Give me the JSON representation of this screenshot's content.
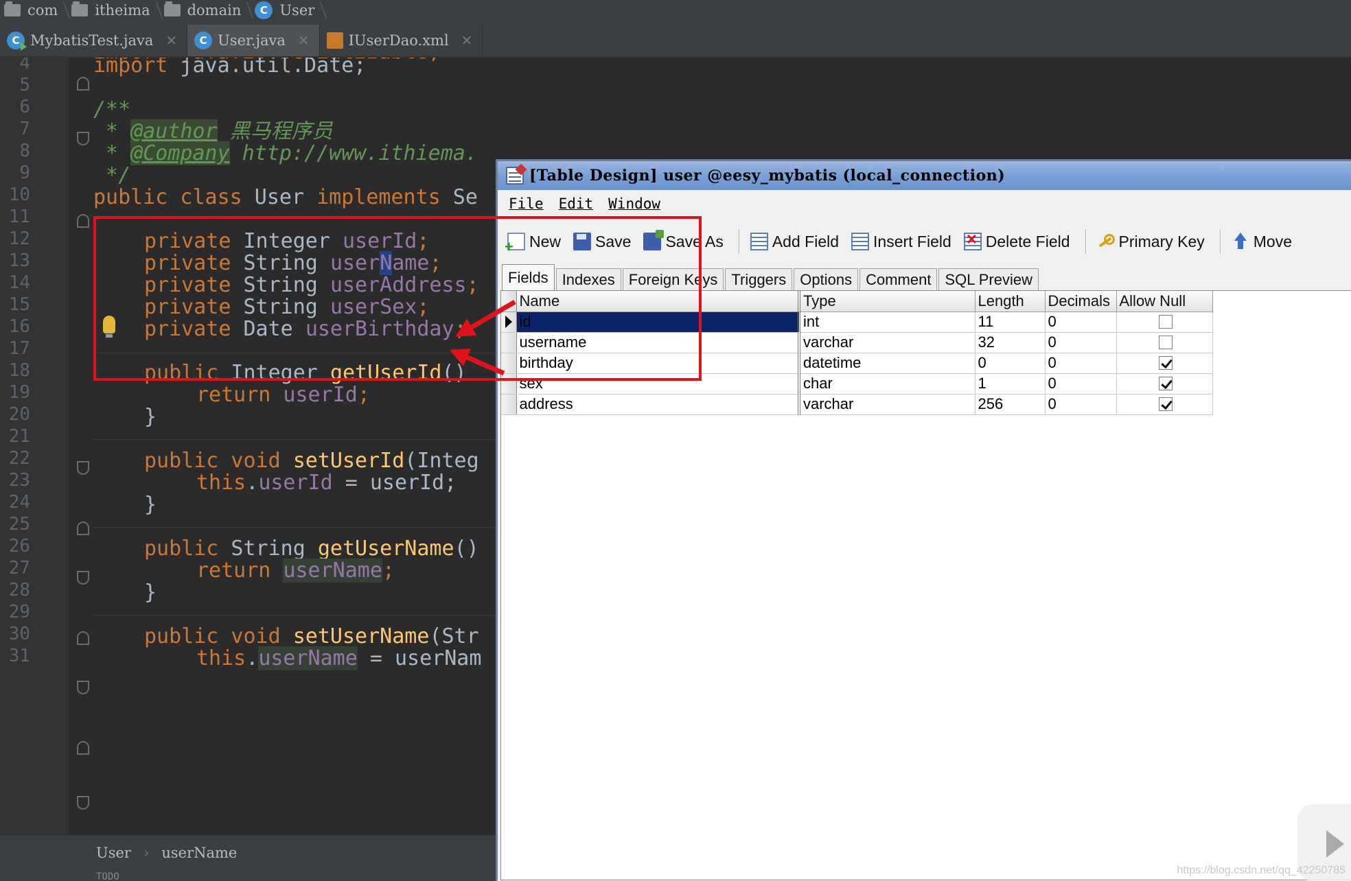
{
  "breadcrumb": [
    "com",
    "itheima",
    "domain",
    "User"
  ],
  "editor_tabs": [
    {
      "label": "MybatisTest.java",
      "icon": "java-run-icon"
    },
    {
      "label": "User.java",
      "icon": "java-class-icon"
    },
    {
      "label": "IUserDao.xml",
      "icon": "xml-file-icon"
    }
  ],
  "line_numbers": [
    "4",
    "5",
    "6",
    "7",
    "8",
    "9",
    "10",
    "11",
    "12",
    "13",
    "14",
    "15",
    "16",
    "17",
    "18",
    "19",
    "20",
    "21",
    "22",
    "23",
    "24",
    "25",
    "26",
    "27",
    "28",
    "29",
    "30",
    "31"
  ],
  "code": {
    "partial_top": "import java.io.Serializable;",
    "l4_kw": "import",
    "l4_rest": " java.util.Date;",
    "l6": "/**",
    "l7_star": " * ",
    "l7_tag": "@author",
    "l7_text": " 黑马程序员",
    "l8_star": " * ",
    "l8_tag": "@Company",
    "l8_text": " http://www.ithiema.",
    "l9": " */",
    "l10_kw1": "public class",
    "l10_name": " User ",
    "l10_kw2": "implements",
    "l10_rest": " Se",
    "l12_kw": "private",
    "l12_type": " Integer ",
    "l12_fld": "userId",
    "l12_end": ";",
    "l13_kw": "private",
    "l13_type": " String ",
    "l13_fld_a": "user",
    "l13_fld_b": "N",
    "l13_fld_c": "ame",
    "l13_end": ";",
    "l14_kw": "private",
    "l14_type": " String ",
    "l14_fld": "userAddress",
    "l14_end": ";",
    "l15_kw": "private",
    "l15_type": " String ",
    "l15_fld": "userSex",
    "l15_end": ";",
    "l16_kw": "private",
    "l16_type": " Date ",
    "l16_fld": "userBirthday",
    "l16_end": ";",
    "l18_kw": "public",
    "l18_type": " Integer ",
    "l18_fn": "getUserId",
    "l18_end": "()",
    "l19_kw": "return",
    "l19_fld": " userId",
    "l19_end": ";",
    "brace": "}",
    "l22_kw": "public void",
    "l22_fn": " setUserId",
    "l22_end": "(Integ",
    "l23_kw": "this",
    "l23_dot": ".",
    "l23_fld": "userId",
    "l23_end": " = userId;",
    "l26_kw": "public",
    "l26_type": " String ",
    "l26_fn": "getUserName",
    "l26_end": "()",
    "l27_kw": "return",
    "l27_sp": " ",
    "l27_fld": "userName",
    "l27_end": ";",
    "l30_kw": "public void",
    "l30_fn": " setUserName",
    "l30_end": "(Str",
    "l31_kw": "this",
    "l31_dot": ".",
    "l31_fld": "userName",
    "l31_end": " = userNam"
  },
  "status_path": [
    "User",
    "userName"
  ],
  "bottom_hint": "TODO",
  "navicat": {
    "title": "[Table Design] user @eesy_mybatis (local_connection)",
    "menu": [
      "File",
      "Edit",
      "Window"
    ],
    "toolbar": [
      {
        "label": "New",
        "icon": "new-table-icon"
      },
      {
        "label": "Save",
        "icon": "save-icon"
      },
      {
        "label": "Save As",
        "icon": "save-as-icon"
      },
      {
        "label": "Add Field",
        "icon": "add-field-icon"
      },
      {
        "label": "Insert Field",
        "icon": "insert-field-icon"
      },
      {
        "label": "Delete Field",
        "icon": "delete-field-icon"
      },
      {
        "label": "Primary Key",
        "icon": "key-icon"
      },
      {
        "label": "Move",
        "icon": "move-up-icon"
      }
    ],
    "tabs": [
      "Fields",
      "Indexes",
      "Foreign Keys",
      "Triggers",
      "Options",
      "Comment",
      "SQL Preview"
    ],
    "active_tab": "Fields",
    "columns": [
      "Name",
      "Type",
      "Length",
      "Decimals",
      "Allow Null"
    ],
    "rows": [
      {
        "name": "id",
        "type": "int",
        "length": "11",
        "decimals": "0",
        "allow_null": false,
        "selected": true
      },
      {
        "name": "username",
        "type": "varchar",
        "length": "32",
        "decimals": "0",
        "allow_null": false,
        "selected": false
      },
      {
        "name": "birthday",
        "type": "datetime",
        "length": "0",
        "decimals": "0",
        "allow_null": true,
        "selected": false
      },
      {
        "name": "sex",
        "type": "char",
        "length": "1",
        "decimals": "0",
        "allow_null": true,
        "selected": false
      },
      {
        "name": "address",
        "type": "varchar",
        "length": "256",
        "decimals": "0",
        "allow_null": true,
        "selected": false
      }
    ]
  },
  "annotation_color": "#e0121a",
  "watermark": "https://blog.csdn.net/qq_42250785"
}
